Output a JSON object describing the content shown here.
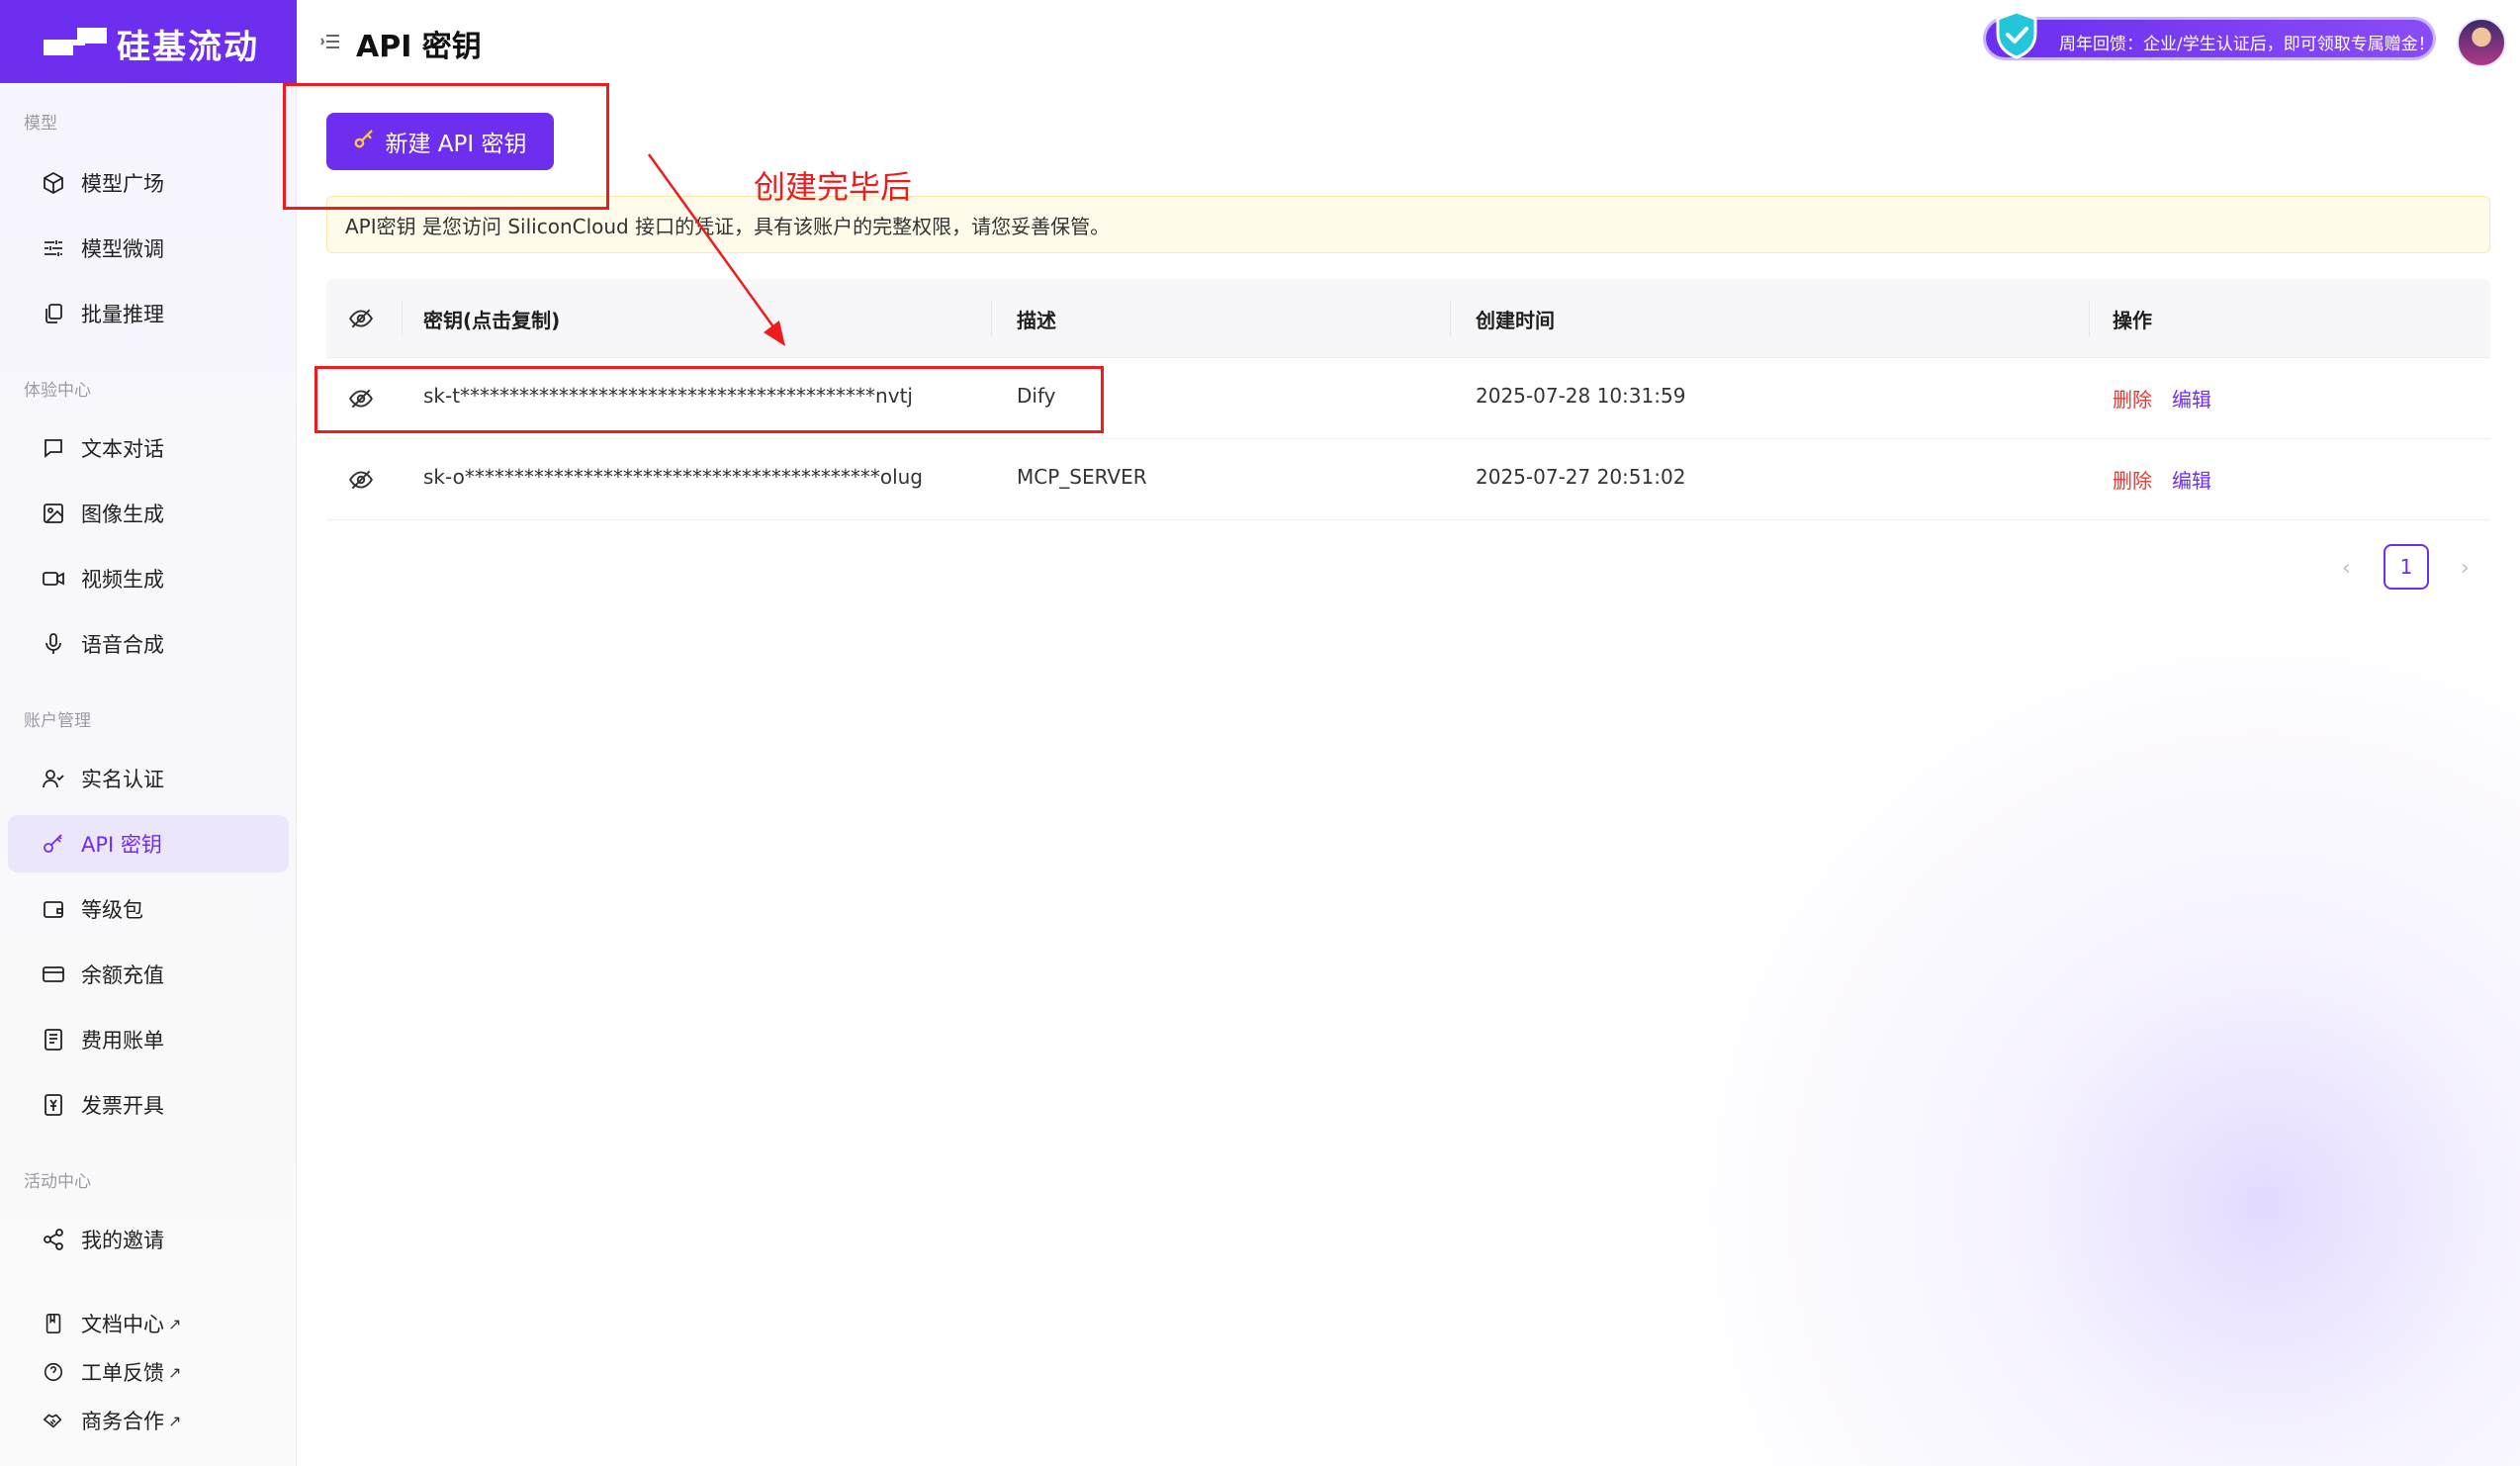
{
  "brand": {
    "name": "硅基流动"
  },
  "header": {
    "title": "API 密钥",
    "promo_text": "周年回馈：企业/学生认证后，即可领取专属赠金！"
  },
  "sidebar": {
    "sections": [
      {
        "label": "模型"
      },
      {
        "label": "体验中心"
      },
      {
        "label": "账户管理"
      },
      {
        "label": "活动中心"
      }
    ],
    "items": [
      {
        "label": "模型广场"
      },
      {
        "label": "模型微调"
      },
      {
        "label": "批量推理"
      },
      {
        "label": "文本对话"
      },
      {
        "label": "图像生成"
      },
      {
        "label": "视频生成"
      },
      {
        "label": "语音合成"
      },
      {
        "label": "实名认证"
      },
      {
        "label": "API 密钥"
      },
      {
        "label": "等级包"
      },
      {
        "label": "余额充值"
      },
      {
        "label": "费用账单"
      },
      {
        "label": "发票开具"
      },
      {
        "label": "我的邀请"
      }
    ],
    "footer_links": [
      {
        "label": "文档中心"
      },
      {
        "label": "工单反馈"
      },
      {
        "label": "商务合作"
      }
    ],
    "external_glyph": "↗"
  },
  "main": {
    "new_button_label": "新建 API 密钥",
    "alert_text": "API密钥 是您访问 SiliconCloud 接口的凭证，具有该账户的完整权限，请您妥善保管。",
    "table": {
      "columns": [
        "密钥(点击复制)",
        "描述",
        "创建时间",
        "操作"
      ],
      "rows": [
        {
          "key": "sk-t******************************************nvtj",
          "description": "Dify",
          "created": "2025-07-28 10:31:59",
          "delete": "删除",
          "edit": "编辑"
        },
        {
          "key": "sk-o******************************************olug",
          "description": "MCP_SERVER",
          "created": "2025-07-27 20:51:02",
          "delete": "删除",
          "edit": "编辑"
        }
      ]
    },
    "pagination": {
      "current": "1",
      "prev": "‹",
      "next": "›"
    }
  },
  "annotation": {
    "text": "创建完毕后"
  },
  "colors": {
    "accent": "#6e2ef0",
    "danger": "#e53935",
    "annotation": "#ee1c1c"
  }
}
